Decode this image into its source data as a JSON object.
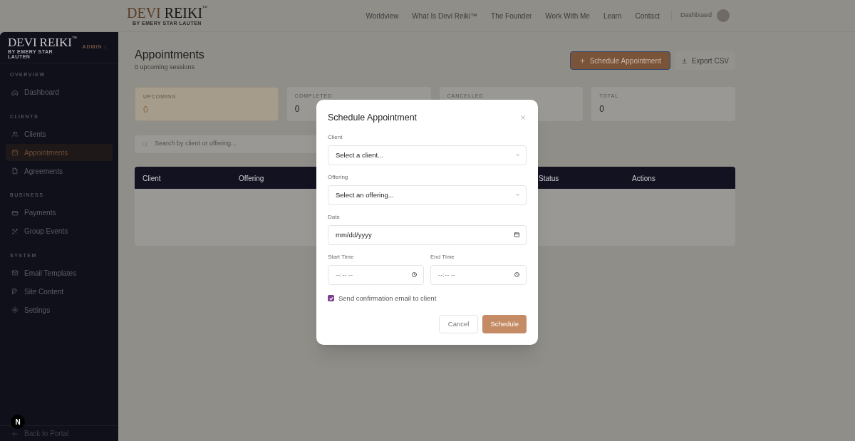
{
  "header": {
    "logo": {
      "first": "DEVI",
      "second": "REIKI",
      "tm": "™",
      "tagline": "BY EMERY STAR LAUTEN"
    },
    "nav": [
      "Worldview",
      "What Is Devi Reiki™",
      "The Founder",
      "Work With Me",
      "Learn",
      "Contact"
    ],
    "dashboard_link": "Dashboard"
  },
  "sidebar": {
    "logo": {
      "first": "DEVI",
      "second": "REIKI",
      "tm": "™",
      "tagline": "BY EMERY STAR LAUTEN"
    },
    "badge": "ADMIN",
    "sections": [
      {
        "title": "OVERVIEW",
        "items": [
          {
            "label": "Dashboard",
            "selected": false
          }
        ]
      },
      {
        "title": "CLIENTS",
        "items": [
          {
            "label": "Clients",
            "selected": false
          },
          {
            "label": "Appointments",
            "selected": true
          },
          {
            "label": "Agreements",
            "selected": false
          }
        ]
      },
      {
        "title": "BUSINESS",
        "items": [
          {
            "label": "Payments",
            "selected": false
          },
          {
            "label": "Group Events",
            "selected": false
          }
        ]
      },
      {
        "title": "SYSTEM",
        "items": [
          {
            "label": "Email Templates",
            "selected": false
          },
          {
            "label": "Site Content",
            "selected": false
          },
          {
            "label": "Settings",
            "selected": false
          }
        ]
      }
    ],
    "dev_badge": "N",
    "footer_link": "Back to Portal"
  },
  "page": {
    "title": "Appointments",
    "subtitle": "0 upcoming sessions",
    "primary_button": "Schedule Appointment",
    "export_button": "Export CSV",
    "stats": [
      {
        "label": "UPCOMING",
        "value": "0",
        "selected": true
      },
      {
        "label": "COMPLETED",
        "value": "0",
        "selected": false
      },
      {
        "label": "CANCELLED",
        "selected": false
      },
      {
        "label": "TOTAL",
        "value": "0",
        "selected": false
      }
    ],
    "search": {
      "placeholder": "Search by client or offering..."
    },
    "table": {
      "columns": [
        "Client",
        "Offering",
        "Status",
        "Actions"
      ]
    }
  },
  "modal": {
    "title": "Schedule Appointment",
    "fields": [
      {
        "label": "Client",
        "kind": "select",
        "placeholder": "Select a client..."
      },
      {
        "label": "Offering",
        "kind": "select",
        "placeholder": "Select an offering..."
      },
      {
        "label": "Date",
        "kind": "date",
        "placeholder": "mm/dd/yyyy"
      }
    ],
    "time_fields": [
      {
        "label": "Start Time",
        "placeholder": "--:-- --"
      },
      {
        "label": "End Time",
        "placeholder": "--:-- --"
      }
    ],
    "confirmation": {
      "label": "Send confirmation email to client",
      "checked": true
    },
    "cancel_button": "Cancel",
    "submit_button": "Schedule"
  }
}
